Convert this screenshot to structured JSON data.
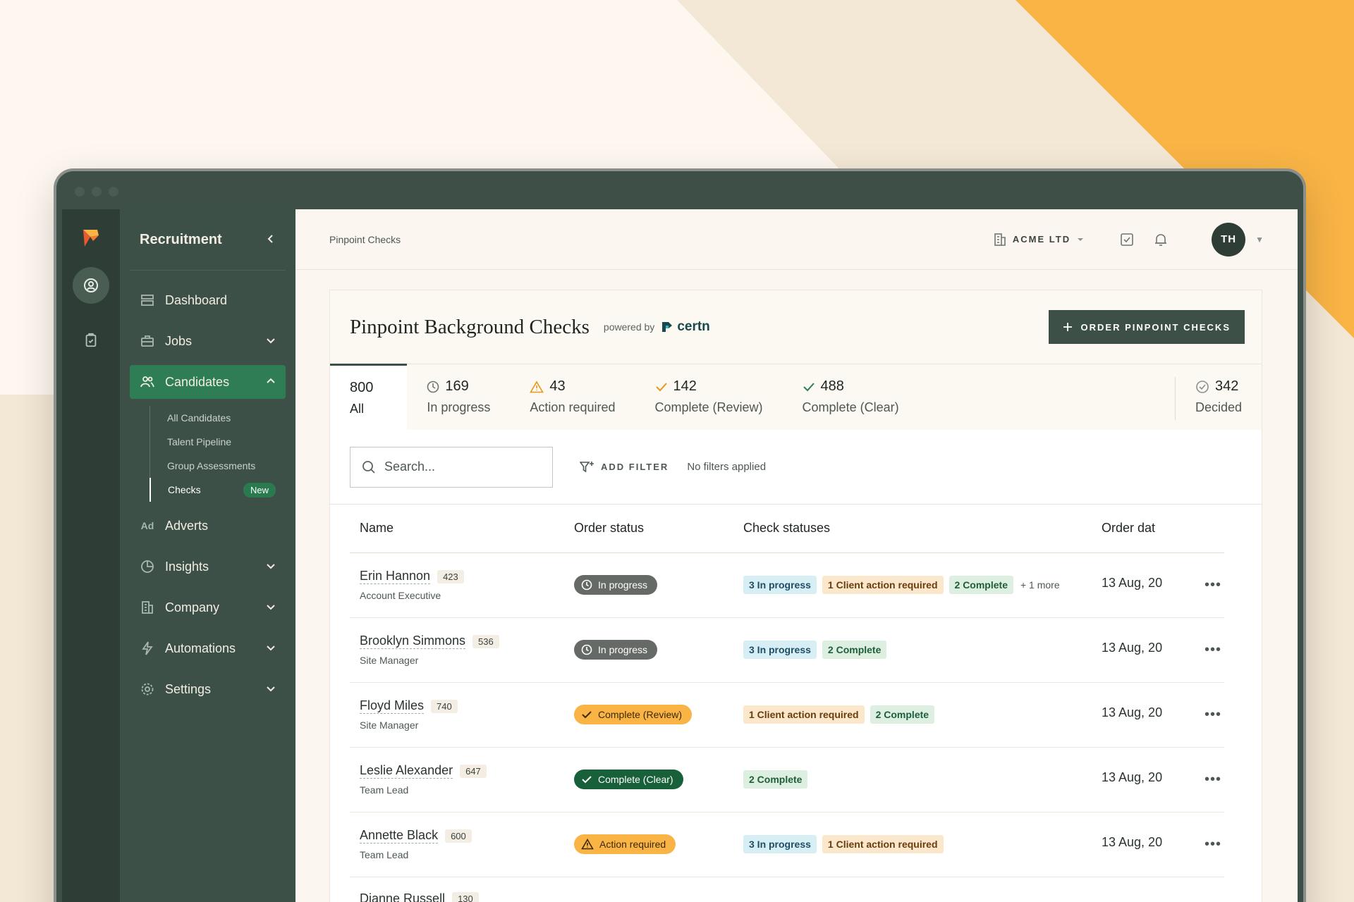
{
  "sidebar": {
    "title": "Recruitment",
    "items": [
      {
        "label": "Dashboard"
      },
      {
        "label": "Jobs"
      },
      {
        "label": "Candidates"
      },
      {
        "label": "Adverts"
      },
      {
        "label": "Insights"
      },
      {
        "label": "Company"
      },
      {
        "label": "Automations"
      },
      {
        "label": "Settings"
      }
    ],
    "candidates_sub": [
      "All Candidates",
      "Talent Pipeline",
      "Group Assessments",
      "Checks"
    ],
    "new_badge": "New",
    "adverts_icon_text": "Ad"
  },
  "topbar": {
    "breadcrumb": "Pinpoint Checks",
    "org": "ACME LTD",
    "avatar": "TH"
  },
  "card": {
    "title": "Pinpoint Background Checks",
    "powered_by": "powered by",
    "brand": "certn",
    "order_button": "ORDER PINPOINT CHECKS"
  },
  "tabs": [
    {
      "count": "800",
      "label": "All"
    },
    {
      "count": "169",
      "label": "In progress"
    },
    {
      "count": "43",
      "label": "Action required"
    },
    {
      "count": "142",
      "label": "Complete (Review)"
    },
    {
      "count": "488",
      "label": "Complete (Clear)"
    },
    {
      "count": "342",
      "label": "Decided"
    }
  ],
  "filters": {
    "search_placeholder": "Search...",
    "add_filter": "ADD FILTER",
    "status": "No filters applied"
  },
  "table": {
    "headers": [
      "Name",
      "Order status",
      "Check statuses",
      "Order dat"
    ],
    "rows": [
      {
        "name": "Erin Hannon",
        "id": "423",
        "role": "Account Executive",
        "status": "In progress",
        "checks": [
          "3 In progress",
          "1 Client action required",
          "2 Complete"
        ],
        "more": "+ 1 more",
        "date": "13 Aug, 20"
      },
      {
        "name": "Brooklyn Simmons",
        "id": "536",
        "role": "Site Manager",
        "status": "In progress",
        "checks": [
          "3 In progress",
          "2 Complete"
        ],
        "date": "13 Aug, 20"
      },
      {
        "name": "Floyd Miles",
        "id": "740",
        "role": "Site Manager",
        "status": "Complete (Review)",
        "checks": [
          "1 Client action required",
          "2 Complete"
        ],
        "date": "13 Aug, 20"
      },
      {
        "name": "Leslie Alexander",
        "id": "647",
        "role": "Team Lead",
        "status": "Complete (Clear)",
        "checks": [
          "2 Complete"
        ],
        "date": "13 Aug, 20"
      },
      {
        "name": "Annette Black",
        "id": "600",
        "role": "Team Lead",
        "status": "Action required",
        "checks": [
          "3 In progress",
          "1 Client action required"
        ],
        "date": "13 Aug, 20"
      },
      {
        "name": "Dianne Russell",
        "id": "130"
      }
    ],
    "row_menu": "•••"
  }
}
